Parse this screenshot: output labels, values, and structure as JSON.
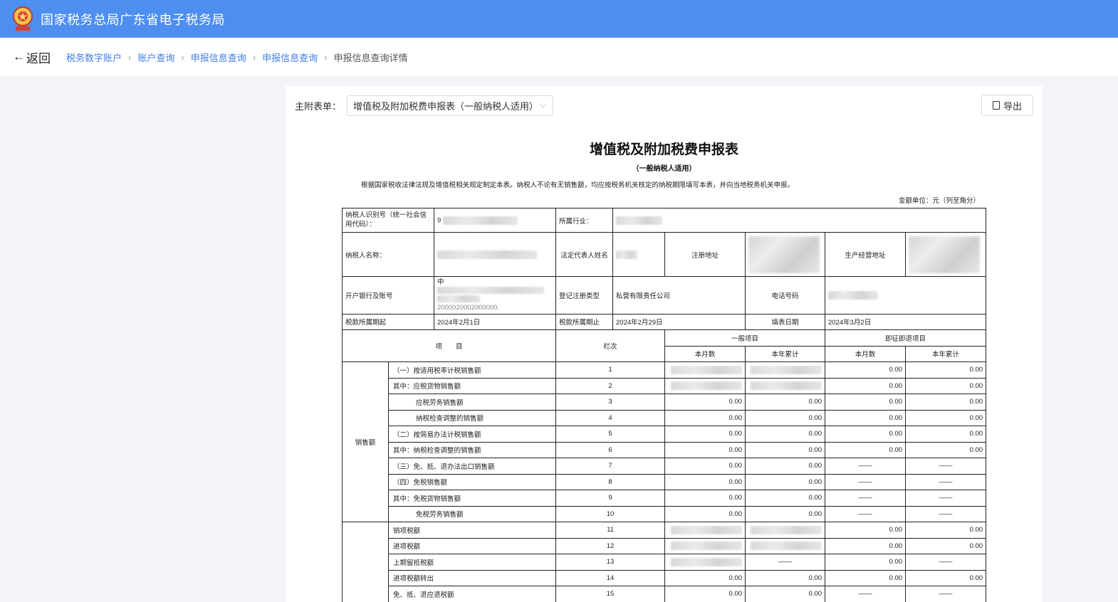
{
  "header": {
    "title": "国家税务总局广东省电子税务局"
  },
  "nav": {
    "back_label": "返回",
    "breadcrumbs": [
      "税务数字账户",
      "账户查询",
      "申报信息查询",
      "申报信息查询",
      "申报信息查询详情"
    ]
  },
  "toolbar": {
    "select_label": "主附表单：",
    "select_value": "增值税及附加税费申报表（一般纳税人适用）",
    "export_label": "导出"
  },
  "document": {
    "title": "增值税及附加税费申报表",
    "subtitle": "（一般纳税人适用）",
    "note": "根据国家税收法律法规及增值税相关规定制定本表。纳税人不论有无销售额，均应按税务机关核定的纳税期限填写本表，并向当地税务机关申报。",
    "unit": "金额单位：元（列至角分）",
    "info": {
      "taxpayer_id_label": "纳税人识别号（统一社会信用代码）：",
      "taxpayer_id_prefix": "9",
      "industry_label": "所属行业：",
      "name_label": "纳税人名称：",
      "legal_rep_label": "法定代表人姓名",
      "reg_addr_label": "注册地址",
      "biz_addr_label": "生产经营地址",
      "bank_label": "开户银行及账号",
      "bank_prefix": "中",
      "bank_account_tail": "2000020002000000.",
      "reg_type_label": "登记注册类型",
      "reg_type_value": "私营有限责任公司",
      "phone_label": "电话号码",
      "period_start_label": "税款所属期起",
      "period_start_value": "2024年2月1日",
      "period_end_label": "税款所属期止",
      "period_end_value": "2024年2月29日",
      "fill_date_label": "填表日期",
      "fill_date_value": "2024年3月2日"
    },
    "columns": {
      "item": "项　　目",
      "line": "栏次",
      "general": "一般项目",
      "instant": "即征即退项目",
      "month": "本月数",
      "year": "本年累计"
    },
    "group_sales": "销售额",
    "dash": "——",
    "rows": [
      {
        "label": "（一）按适用税率计税销售额",
        "line": "1",
        "m": "",
        "y": "",
        "im": "0.00",
        "iy": "0.00"
      },
      {
        "label": "其中：应税货物销售额",
        "line": "2",
        "m": "",
        "y": "",
        "im": "0.00",
        "iy": "0.00"
      },
      {
        "label": "应税劳务销售额",
        "line": "3",
        "m": "0.00",
        "y": "0.00",
        "im": "0.00",
        "iy": "0.00"
      },
      {
        "label": "纳税检查调整的销售额",
        "line": "4",
        "m": "0.00",
        "y": "0.00",
        "im": "0.00",
        "iy": "0.00"
      },
      {
        "label": "（二）按简易办法计税销售额",
        "line": "5",
        "m": "0.00",
        "y": "0.00",
        "im": "0.00",
        "iy": "0.00"
      },
      {
        "label": "其中：纳税检查调整的销售额",
        "line": "6",
        "m": "0.00",
        "y": "0.00",
        "im": "0.00",
        "iy": "0.00"
      },
      {
        "label": "（三）免、抵、退办法出口销售额",
        "line": "7",
        "m": "0.00",
        "y": "0.00",
        "im": "——",
        "iy": "——"
      },
      {
        "label": "（四）免税销售额",
        "line": "8",
        "m": "0.00",
        "y": "0.00",
        "im": "——",
        "iy": "——"
      },
      {
        "label": "其中：免税货物销售额",
        "line": "9",
        "m": "0.00",
        "y": "0.00",
        "im": "——",
        "iy": "——"
      },
      {
        "label": "免税劳务销售额",
        "line": "10",
        "m": "0.00",
        "y": "0.00",
        "im": "——",
        "iy": "——"
      },
      {
        "label": "销项税额",
        "line": "11",
        "m": "",
        "y": "",
        "im": "0.00",
        "iy": "0.00"
      },
      {
        "label": "进项税额",
        "line": "12",
        "m": "",
        "y": "",
        "im": "0.00",
        "iy": "0.00"
      },
      {
        "label": "上期留抵税额",
        "line": "13",
        "m": "",
        "y": "——",
        "im": "0.00",
        "iy": "——"
      },
      {
        "label": "进项税额转出",
        "line": "14",
        "m": "0.00",
        "y": "0.00",
        "im": "0.00",
        "iy": "0.00"
      },
      {
        "label": "免、抵、退应退税额",
        "line": "15",
        "m": "0.00",
        "y": "0.00",
        "im": "——",
        "iy": "——"
      }
    ]
  }
}
